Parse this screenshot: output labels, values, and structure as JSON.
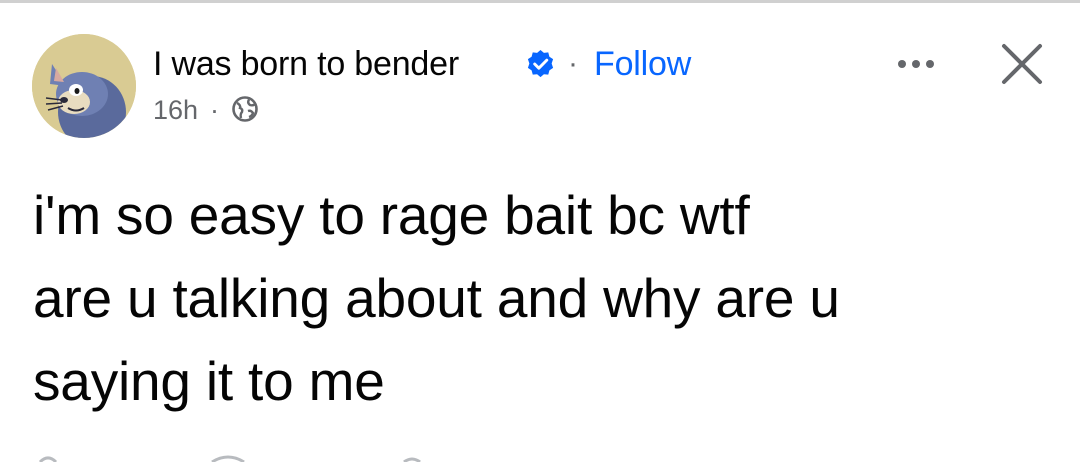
{
  "header": {
    "author_name": "I was born to bender",
    "separator": "·",
    "follow_label": "Follow",
    "timestamp": "16h",
    "time_separator": "·"
  },
  "post": {
    "text": "i'm so easy to rage bait bc wtf\nare u talking about and why are u\nsaying it to me"
  },
  "icons": {
    "avatar": "avatar",
    "verified": "verified-badge-icon",
    "audience": "globe-icon",
    "more": "more-options-icon",
    "close": "close-icon"
  },
  "colors": {
    "accent": "#0866ff",
    "text_primary": "#050505",
    "text_secondary": "#65676b"
  }
}
